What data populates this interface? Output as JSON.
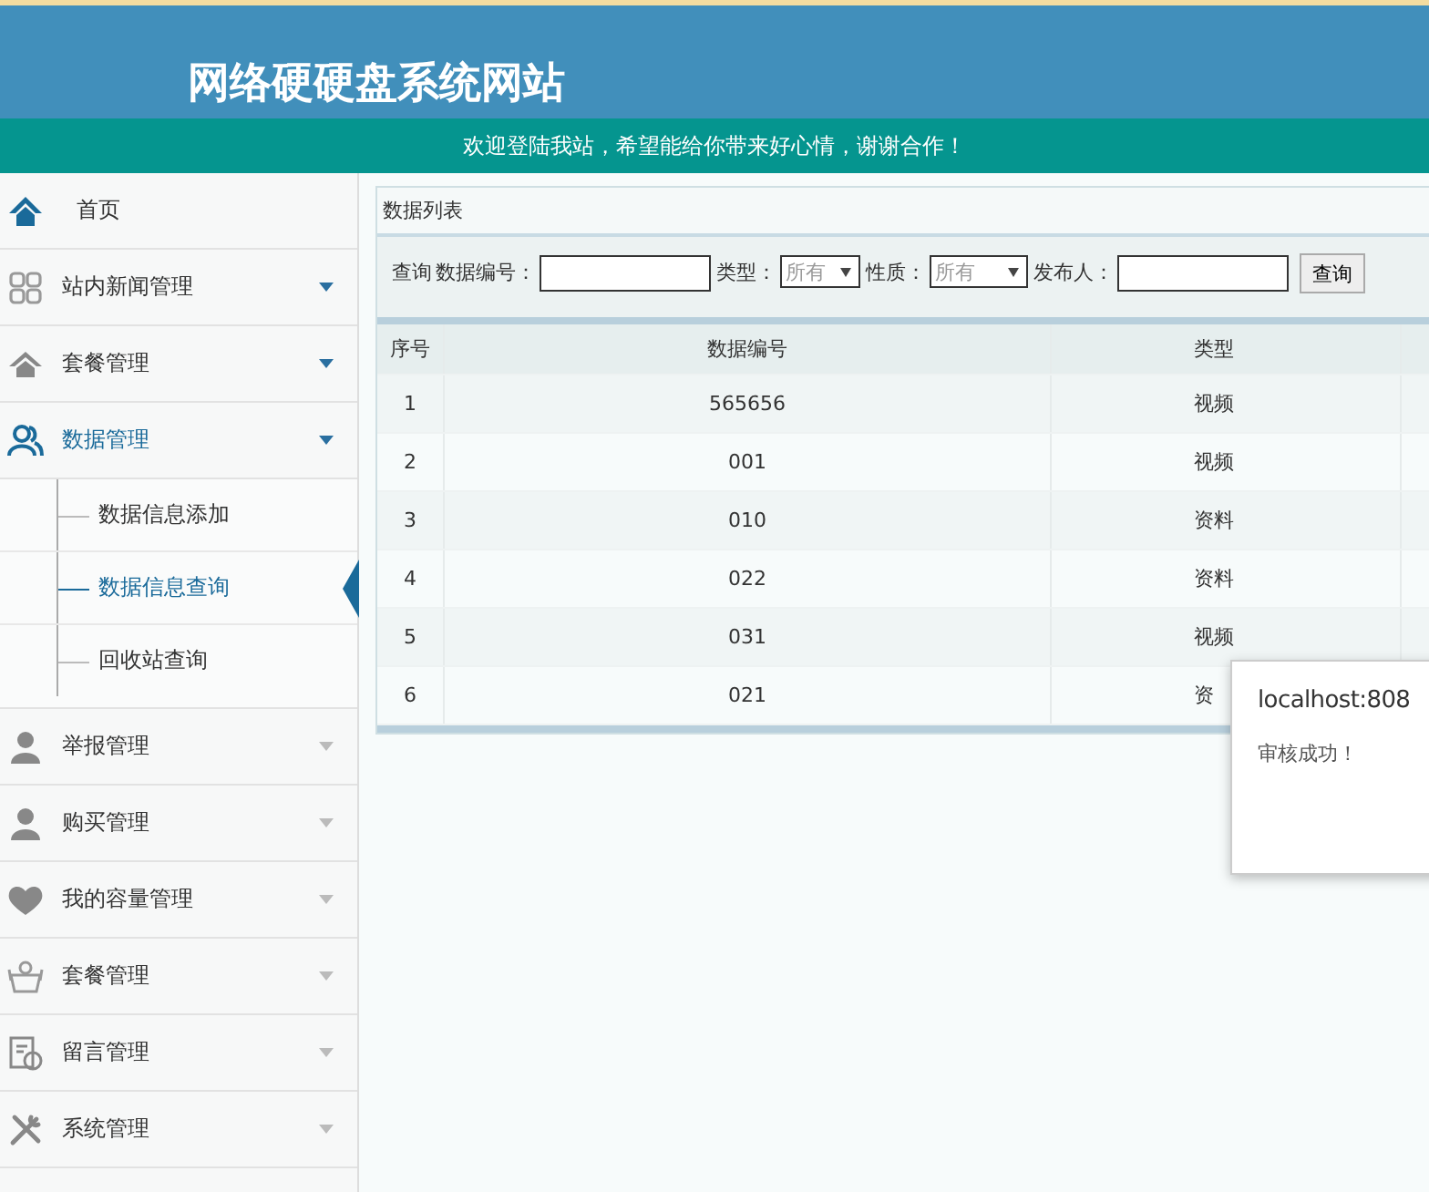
{
  "header": {
    "title": "网络硬硬盘系统网站",
    "welcome": "欢迎登陆我站，希望能给你带来好心情，谢谢合作！"
  },
  "sidebar": {
    "items": [
      {
        "label": "首页",
        "kind": "link",
        "expanded": false
      },
      {
        "label": "站内新闻管理",
        "kind": "menu",
        "expanded": false
      },
      {
        "label": "套餐管理",
        "kind": "menu",
        "expanded": false
      },
      {
        "label": "数据管理",
        "kind": "menu",
        "expanded": true,
        "children": [
          {
            "label": "数据信息添加",
            "selected": false
          },
          {
            "label": "数据信息查询",
            "selected": true
          },
          {
            "label": "回收站查询",
            "selected": false
          }
        ]
      },
      {
        "label": "举报管理",
        "kind": "menu",
        "expanded": false
      },
      {
        "label": "购买管理",
        "kind": "menu",
        "expanded": false
      },
      {
        "label": "我的容量管理",
        "kind": "menu",
        "expanded": false
      },
      {
        "label": "套餐管理",
        "kind": "menu",
        "expanded": false
      },
      {
        "label": "留言管理",
        "kind": "menu",
        "expanded": false
      },
      {
        "label": "系统管理",
        "kind": "menu",
        "expanded": false
      }
    ]
  },
  "panel": {
    "title": "数据列表",
    "search": {
      "prefix": "查询",
      "fields": [
        {
          "kind": "text",
          "label": "数据编号："
        },
        {
          "kind": "select",
          "label": "类型：",
          "value": "所有"
        },
        {
          "kind": "select",
          "label": "性质：",
          "value": "所有"
        },
        {
          "kind": "text",
          "label": "发布人："
        }
      ],
      "button": "查询"
    },
    "table": {
      "columns": [
        "序号",
        "数据编号",
        "类型"
      ],
      "rows": [
        [
          "1",
          "565656",
          "视频"
        ],
        [
          "2",
          "001",
          "视频"
        ],
        [
          "3",
          "010",
          "资料"
        ],
        [
          "4",
          "022",
          "资料"
        ],
        [
          "5",
          "031",
          "视频"
        ],
        [
          "6",
          "021",
          "资"
        ]
      ]
    }
  },
  "dialog": {
    "title": "localhost:808",
    "message": "审核成功！"
  }
}
